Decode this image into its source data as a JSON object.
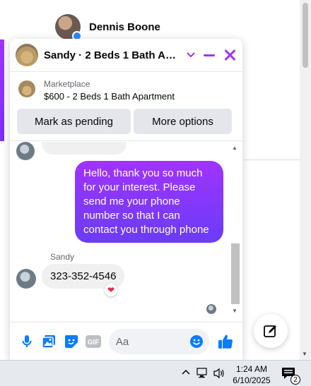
{
  "background": {
    "contact_name": "Dennis Boone"
  },
  "chat": {
    "title": "Sandy · 2 Beds 1 Bath Apartment",
    "listing": {
      "category": "Marketplace",
      "name": "$600 - 2 Beds 1 Bath Apartment",
      "primary_action": "Mark as pending",
      "secondary_action": "More options"
    },
    "messages": [
      {
        "direction": "outgoing",
        "text": "Hello, thank you so much for your interest. Please send me your phone number so that I can contact you through phone"
      },
      {
        "direction": "incoming",
        "sender": "Sandy",
        "text": "323-352-4546",
        "reaction": "❤"
      }
    ],
    "composer": {
      "placeholder": "Aa"
    },
    "colors": {
      "accent": "#a033ff",
      "accent_end": "#6a3cf7",
      "like": "#0a7cff"
    }
  },
  "taskbar": {
    "time": "1:24 AM",
    "date": "6/10/2025",
    "notification_count": "2"
  }
}
